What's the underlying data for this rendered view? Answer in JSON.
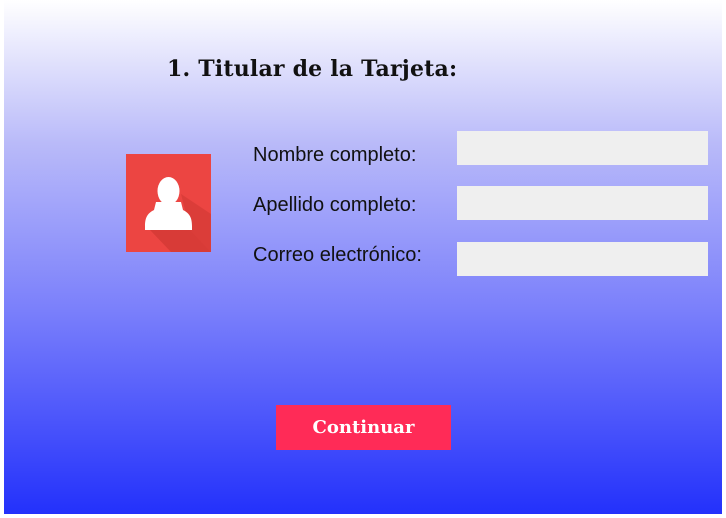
{
  "section": {
    "title": "1. Titular de la Tarjeta:"
  },
  "avatar": {
    "icon": "user-silhouette-icon",
    "color": "#ec4542"
  },
  "form": {
    "fields": [
      {
        "label": "Nombre completo:",
        "value": "",
        "placeholder": ""
      },
      {
        "label": "Apellido completo:",
        "value": "",
        "placeholder": ""
      },
      {
        "label": "Correo electrónico:",
        "value": "",
        "placeholder": ""
      }
    ]
  },
  "actions": {
    "continue_label": "Continuar",
    "continue_color": "#ff2b57"
  },
  "colors": {
    "background_top": "#ffffff",
    "background_bottom": "#2331fb"
  }
}
